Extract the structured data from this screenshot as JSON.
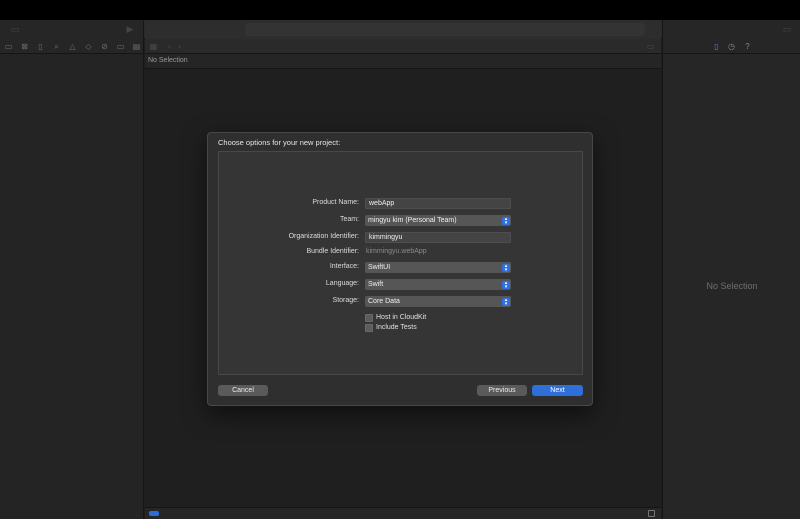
{
  "window": {
    "breadcrumb_status": "No Selection"
  },
  "inspector": {
    "empty_text": "No Selection"
  },
  "dialog": {
    "title": "Choose options for your new project:",
    "fields": {
      "product_name": {
        "label": "Product Name:",
        "value": "webApp"
      },
      "team": {
        "label": "Team:",
        "value": "mingyu kim (Personal Team)"
      },
      "organization_identifier": {
        "label": "Organization Identifier:",
        "value": "kimmingyu"
      },
      "bundle_identifier": {
        "label": "Bundle Identifier:",
        "value": "kimmingyu.webApp"
      },
      "interface": {
        "label": "Interface:",
        "value": "SwiftUI"
      },
      "language": {
        "label": "Language:",
        "value": "Swift"
      },
      "storage": {
        "label": "Storage:",
        "value": "Core Data"
      }
    },
    "checkboxes": {
      "host_in_cloudkit": {
        "label": "Host in CloudKit",
        "checked": false
      },
      "include_tests": {
        "label": "Include Tests",
        "checked": false
      }
    },
    "buttons": {
      "cancel": "Cancel",
      "previous": "Previous",
      "next": "Next"
    }
  },
  "icons": {
    "navigator": [
      "folder-icon",
      "source-control-icon",
      "bookmark-icon",
      "search-icon",
      "warning-icon",
      "test-icon",
      "debug-icon",
      "breakpoint-icon",
      "report-icon"
    ],
    "inspector": [
      "file-inspector-icon",
      "history-icon",
      "help-icon"
    ]
  },
  "colors": {
    "accent": "#2f6fd8",
    "background": "#1e1e1e",
    "sheet": "#2f2f2f"
  }
}
